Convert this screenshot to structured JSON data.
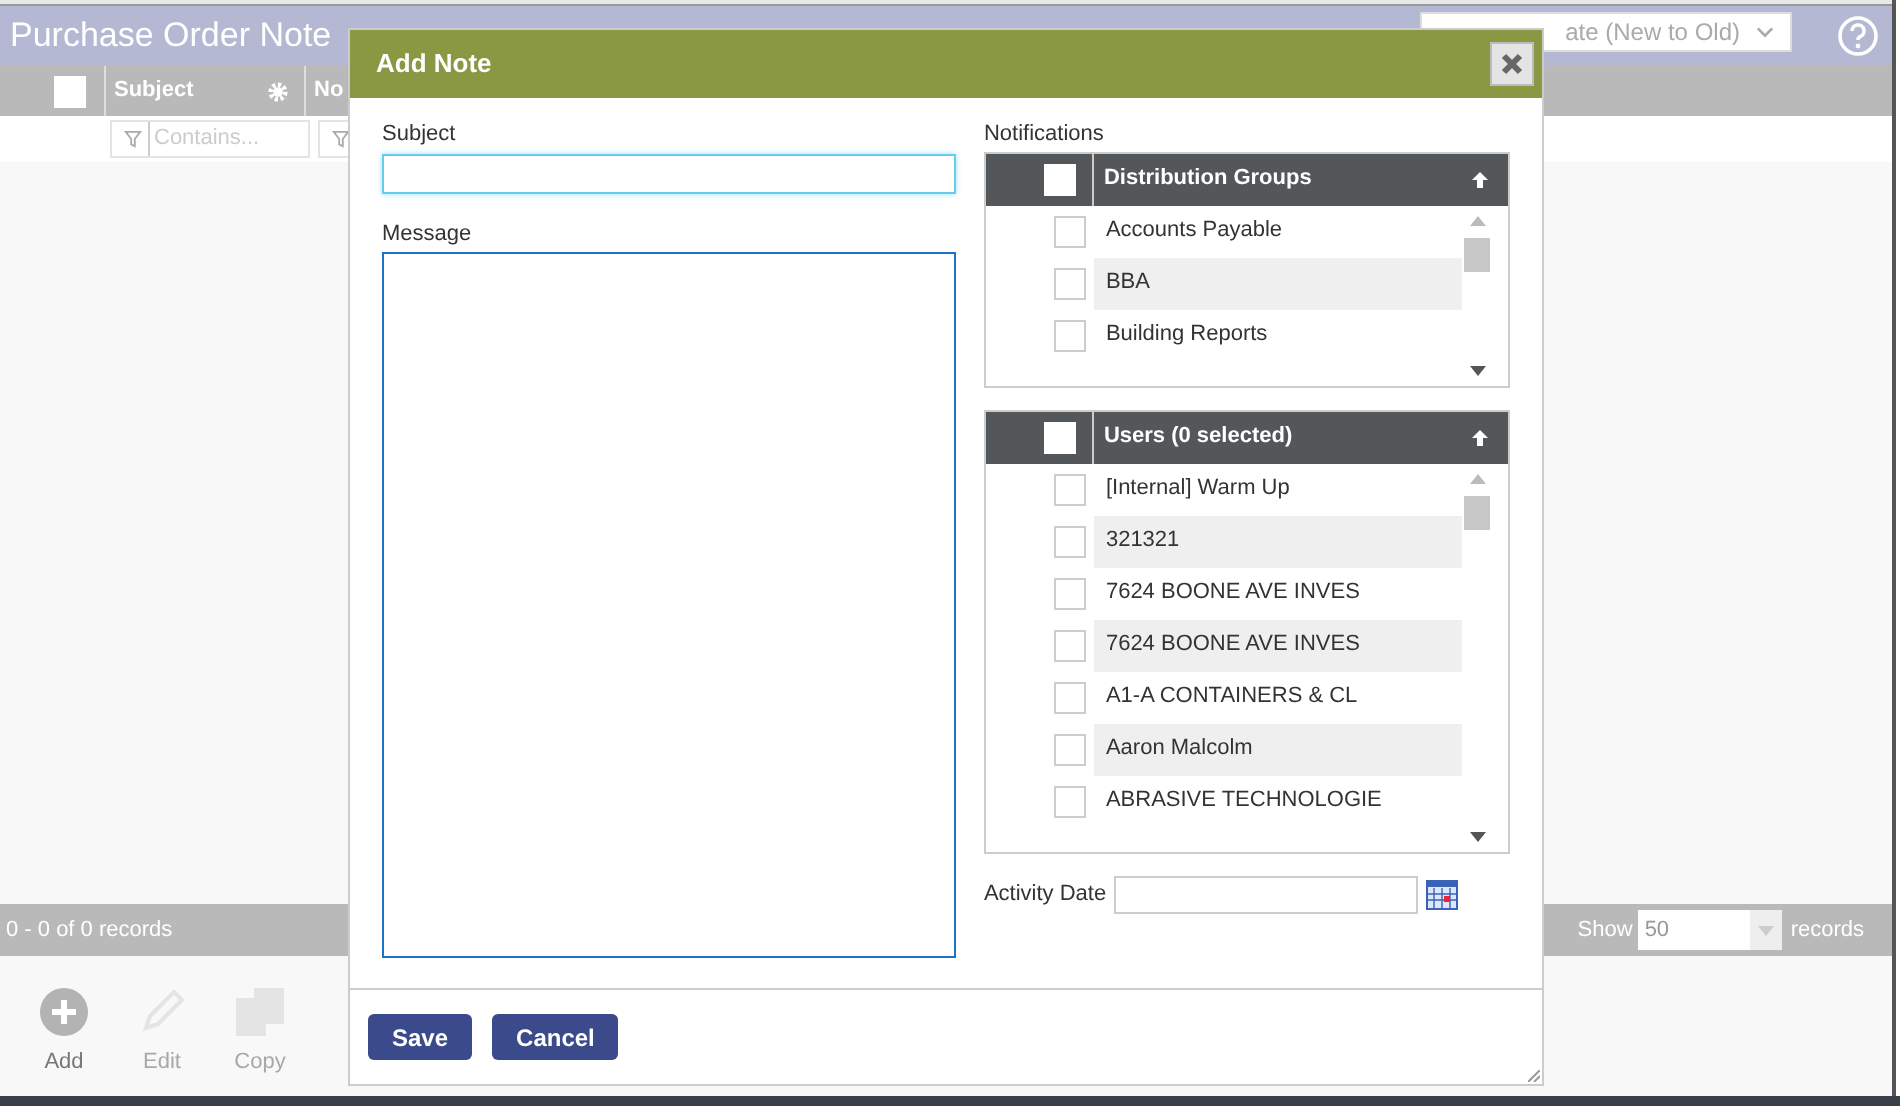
{
  "page": {
    "title": "Purchase Order Note",
    "sort_select": {
      "value": "ate (New to Old)"
    },
    "grid": {
      "select_all_checked": false,
      "columns": [
        {
          "label": "Subject",
          "filter_placeholder": "Contains..."
        },
        {
          "label": "No"
        }
      ]
    },
    "pager": {
      "summary": "0 - 0 of 0 records",
      "show_label": "Show",
      "page_size": "50",
      "records_label": "records"
    },
    "toolbar": [
      {
        "kind": "add",
        "label": "Add",
        "disabled": false
      },
      {
        "kind": "edit",
        "label": "Edit",
        "disabled": true
      },
      {
        "kind": "copy",
        "label": "Copy",
        "disabled": true
      }
    ]
  },
  "dialog": {
    "title": "Add Note",
    "subject": {
      "label": "Subject",
      "focused": true
    },
    "message": {
      "label": "Message"
    },
    "notifications": {
      "label": "Notifications",
      "lists": [
        {
          "header": "Distribution Groups",
          "all_checked": false,
          "items": [
            {
              "label": "Accounts Payable",
              "checked": false
            },
            {
              "label": "BBA",
              "checked": false
            },
            {
              "label": "Building Reports",
              "checked": false
            }
          ]
        },
        {
          "header": "Users (0 selected)",
          "all_checked": false,
          "items": [
            {
              "label": "[Internal] Warm Up",
              "checked": false
            },
            {
              "label": "321321",
              "checked": false
            },
            {
              "label": "7624 BOONE AVE INVES",
              "checked": false
            },
            {
              "label": "7624 BOONE AVE INVES",
              "checked": false
            },
            {
              "label": "A1-A CONTAINERS & CL",
              "checked": false
            },
            {
              "label": "Aaron Malcolm",
              "checked": false
            },
            {
              "label": "ABRASIVE TECHNOLOGIE",
              "checked": false
            }
          ]
        }
      ]
    },
    "activity_date": {
      "label": "Activity Date"
    },
    "buttons": [
      "Save",
      "Cancel"
    ]
  }
}
